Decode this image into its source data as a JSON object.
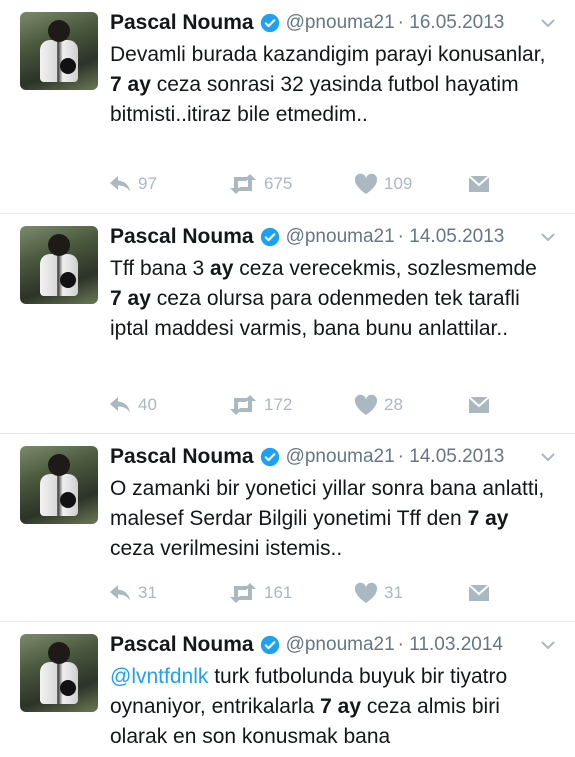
{
  "colors": {
    "name": "#14171a",
    "handle": "#657786",
    "icon": "#aab8c2",
    "verified": "#1da1f2",
    "mention": "#1da1f2",
    "divider": "#e1e8ed"
  },
  "tweets": [
    {
      "name": "Pascal Nouma",
      "handle": "@pnouma21",
      "date": "· 16.05.2013",
      "segments": [
        {
          "t": "Devamli burada kazandigim parayi konusanlar, "
        },
        {
          "t": "7 ay",
          "b": true
        },
        {
          "t": " ceza sonrasi 32 yasinda futbol hayatim bitmisti..itiraz bile etmedim.."
        }
      ],
      "replies": "97",
      "retweets": "675",
      "likes": "109"
    },
    {
      "name": "Pascal Nouma",
      "handle": "@pnouma21",
      "date": "· 14.05.2013",
      "segments": [
        {
          "t": "Tff bana 3 "
        },
        {
          "t": "ay",
          "b": true
        },
        {
          "t": " ceza verecekmis, sozlesmemde "
        },
        {
          "t": "7 ay",
          "b": true
        },
        {
          "t": " ceza olursa para odenmeden tek tarafli iptal maddesi varmis, bana bunu anlattilar.."
        }
      ],
      "replies": "40",
      "retweets": "172",
      "likes": "28"
    },
    {
      "name": "Pascal Nouma",
      "handle": "@pnouma21",
      "date": "· 14.05.2013",
      "segments": [
        {
          "t": "O zamanki bir yonetici yillar sonra bana anlatti, malesef Serdar Bilgili yonetimi Tff den "
        },
        {
          "t": "7 ay",
          "b": true
        },
        {
          "t": " ceza verilmesini istemis.."
        }
      ],
      "replies": "31",
      "retweets": "161",
      "likes": "31"
    },
    {
      "name": "Pascal Nouma",
      "handle": "@pnouma21",
      "date": "· 11.03.2014",
      "segments": [
        {
          "t": "@lvntfdnlk",
          "m": true
        },
        {
          "t": " turk futbolunda buyuk bir tiyatro oynaniyor, entrikalarla "
        },
        {
          "t": "7 ay",
          "b": true
        },
        {
          "t": " ceza almis biri olarak en son konusmak bana"
        }
      ],
      "replies": "",
      "retweets": "",
      "likes": ""
    }
  ]
}
